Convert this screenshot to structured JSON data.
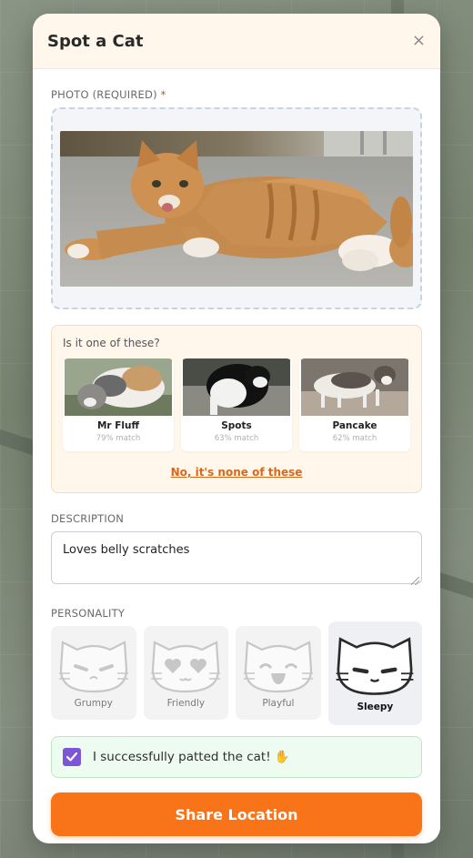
{
  "modal": {
    "title": "Spot a Cat",
    "close_glyph": "×"
  },
  "photo": {
    "label": "PHOTO (REQUIRED)",
    "required_marker": "*"
  },
  "matches": {
    "question": "Is it one of these?",
    "cards": [
      {
        "name": "Mr Fluff",
        "match": "79% match"
      },
      {
        "name": "Spots",
        "match": "63% match"
      },
      {
        "name": "Pancake",
        "match": "62% match"
      }
    ],
    "none_label": "No, it's none of these"
  },
  "description": {
    "label": "DESCRIPTION",
    "value": "Loves belly scratches"
  },
  "personality": {
    "label": "PERSONALITY",
    "options": [
      {
        "label": "Grumpy",
        "icon": "grumpy-cat-face-icon"
      },
      {
        "label": "Friendly",
        "icon": "heart-eyes-cat-face-icon"
      },
      {
        "label": "Playful",
        "icon": "laughing-cat-face-icon"
      },
      {
        "label": "Sleepy",
        "icon": "sleepy-cat-face-icon"
      }
    ],
    "selected": "Sleepy"
  },
  "patted": {
    "label": "I successfully patted the cat! ✋",
    "checked": true
  },
  "submit": {
    "label": "Share Location"
  },
  "colors": {
    "accent": "#f97318",
    "checkbox": "#7b57d6",
    "header_bg": "#fff6ec",
    "link": "#d9691a"
  }
}
